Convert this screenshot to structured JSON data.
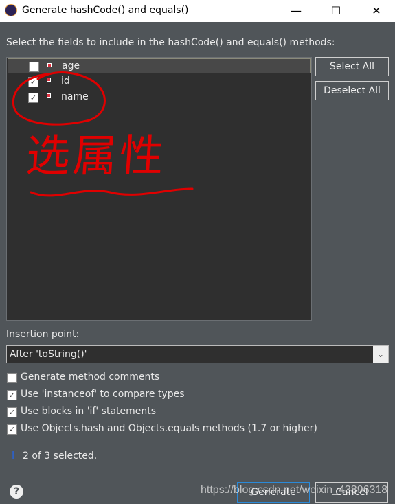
{
  "window": {
    "title": "Generate hashCode() and equals()",
    "minimize": "—",
    "maximize": "☐",
    "close": "✕"
  },
  "instruction": "Select the fields to include in the hashCode() and equals() methods:",
  "fields": [
    {
      "name": "age",
      "checked": false
    },
    {
      "name": "id",
      "checked": true
    },
    {
      "name": "name",
      "checked": true
    }
  ],
  "buttons": {
    "select_all": "Select All",
    "deselect_all": "Deselect All",
    "generate": "Generate",
    "cancel": "Cancel"
  },
  "insertion_point": {
    "label": "Insertion point:",
    "value": "After 'toString()'"
  },
  "options": [
    {
      "label": "Generate method comments",
      "checked": false
    },
    {
      "label": "Use 'instanceof' to compare types",
      "checked": true
    },
    {
      "label": "Use blocks in 'if' statements",
      "checked": true
    },
    {
      "label": "Use Objects.hash and Objects.equals methods (1.7 or higher)",
      "checked": true
    }
  ],
  "status": "2 of 3 selected.",
  "annotation": "选属性",
  "watermark": "https://blog.csdn.net/weixin_43896318",
  "colors": {
    "annotation": "#e00000",
    "background": "#505559",
    "list": "#2f2f2f"
  }
}
